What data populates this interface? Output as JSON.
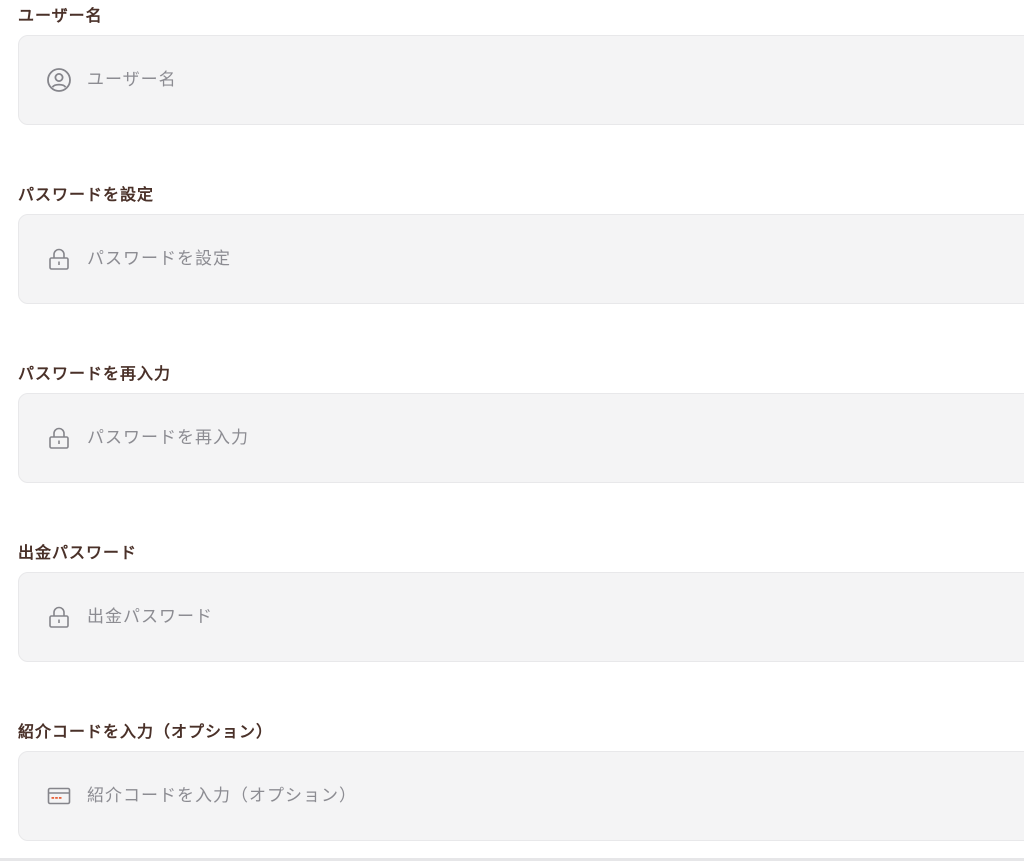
{
  "form": {
    "fields": [
      {
        "id": "username",
        "label": "ユーザー名",
        "placeholder": "ユーザー名",
        "value": "",
        "icon": "user-circle-icon"
      },
      {
        "id": "password",
        "label": "パスワードを設定",
        "placeholder": "パスワードを設定",
        "value": "",
        "icon": "lock-icon"
      },
      {
        "id": "password_confirm",
        "label": "パスワードを再入力",
        "placeholder": "パスワードを再入力",
        "value": "",
        "icon": "lock-icon"
      },
      {
        "id": "withdraw_password",
        "label": "出金パスワード",
        "placeholder": "出金パスワード",
        "value": "",
        "icon": "lock-icon"
      },
      {
        "id": "referral_code",
        "label": "紹介コードを入力（オプション）",
        "placeholder": "紹介コードを入力（オプション）",
        "value": "",
        "icon": "card-icon"
      }
    ]
  },
  "colors": {
    "label": "#4a3129",
    "field_background": "#f4f4f5",
    "placeholder": "#8c8c92",
    "icon": "#85858b",
    "card_icon_accent": "#e8623c"
  }
}
